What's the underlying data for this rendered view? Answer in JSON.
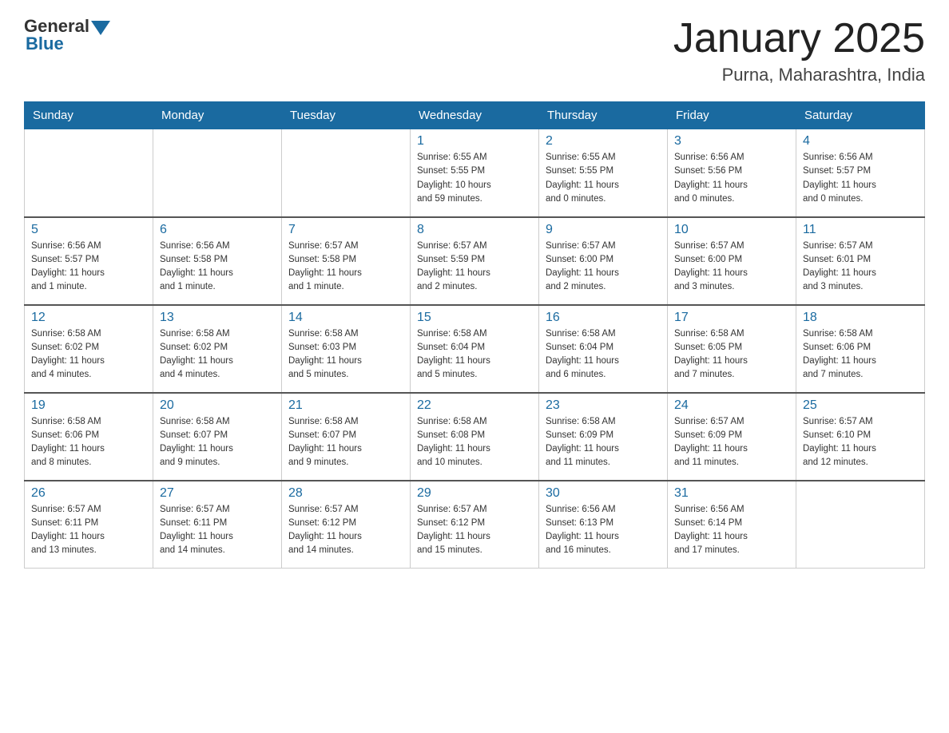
{
  "logo": {
    "general": "General",
    "blue": "Blue"
  },
  "title": {
    "month_year": "January 2025",
    "location": "Purna, Maharashtra, India"
  },
  "headers": [
    "Sunday",
    "Monday",
    "Tuesday",
    "Wednesday",
    "Thursday",
    "Friday",
    "Saturday"
  ],
  "weeks": [
    [
      {
        "day": "",
        "info": ""
      },
      {
        "day": "",
        "info": ""
      },
      {
        "day": "",
        "info": ""
      },
      {
        "day": "1",
        "info": "Sunrise: 6:55 AM\nSunset: 5:55 PM\nDaylight: 10 hours\nand 59 minutes."
      },
      {
        "day": "2",
        "info": "Sunrise: 6:55 AM\nSunset: 5:55 PM\nDaylight: 11 hours\nand 0 minutes."
      },
      {
        "day": "3",
        "info": "Sunrise: 6:56 AM\nSunset: 5:56 PM\nDaylight: 11 hours\nand 0 minutes."
      },
      {
        "day": "4",
        "info": "Sunrise: 6:56 AM\nSunset: 5:57 PM\nDaylight: 11 hours\nand 0 minutes."
      }
    ],
    [
      {
        "day": "5",
        "info": "Sunrise: 6:56 AM\nSunset: 5:57 PM\nDaylight: 11 hours\nand 1 minute."
      },
      {
        "day": "6",
        "info": "Sunrise: 6:56 AM\nSunset: 5:58 PM\nDaylight: 11 hours\nand 1 minute."
      },
      {
        "day": "7",
        "info": "Sunrise: 6:57 AM\nSunset: 5:58 PM\nDaylight: 11 hours\nand 1 minute."
      },
      {
        "day": "8",
        "info": "Sunrise: 6:57 AM\nSunset: 5:59 PM\nDaylight: 11 hours\nand 2 minutes."
      },
      {
        "day": "9",
        "info": "Sunrise: 6:57 AM\nSunset: 6:00 PM\nDaylight: 11 hours\nand 2 minutes."
      },
      {
        "day": "10",
        "info": "Sunrise: 6:57 AM\nSunset: 6:00 PM\nDaylight: 11 hours\nand 3 minutes."
      },
      {
        "day": "11",
        "info": "Sunrise: 6:57 AM\nSunset: 6:01 PM\nDaylight: 11 hours\nand 3 minutes."
      }
    ],
    [
      {
        "day": "12",
        "info": "Sunrise: 6:58 AM\nSunset: 6:02 PM\nDaylight: 11 hours\nand 4 minutes."
      },
      {
        "day": "13",
        "info": "Sunrise: 6:58 AM\nSunset: 6:02 PM\nDaylight: 11 hours\nand 4 minutes."
      },
      {
        "day": "14",
        "info": "Sunrise: 6:58 AM\nSunset: 6:03 PM\nDaylight: 11 hours\nand 5 minutes."
      },
      {
        "day": "15",
        "info": "Sunrise: 6:58 AM\nSunset: 6:04 PM\nDaylight: 11 hours\nand 5 minutes."
      },
      {
        "day": "16",
        "info": "Sunrise: 6:58 AM\nSunset: 6:04 PM\nDaylight: 11 hours\nand 6 minutes."
      },
      {
        "day": "17",
        "info": "Sunrise: 6:58 AM\nSunset: 6:05 PM\nDaylight: 11 hours\nand 7 minutes."
      },
      {
        "day": "18",
        "info": "Sunrise: 6:58 AM\nSunset: 6:06 PM\nDaylight: 11 hours\nand 7 minutes."
      }
    ],
    [
      {
        "day": "19",
        "info": "Sunrise: 6:58 AM\nSunset: 6:06 PM\nDaylight: 11 hours\nand 8 minutes."
      },
      {
        "day": "20",
        "info": "Sunrise: 6:58 AM\nSunset: 6:07 PM\nDaylight: 11 hours\nand 9 minutes."
      },
      {
        "day": "21",
        "info": "Sunrise: 6:58 AM\nSunset: 6:07 PM\nDaylight: 11 hours\nand 9 minutes."
      },
      {
        "day": "22",
        "info": "Sunrise: 6:58 AM\nSunset: 6:08 PM\nDaylight: 11 hours\nand 10 minutes."
      },
      {
        "day": "23",
        "info": "Sunrise: 6:58 AM\nSunset: 6:09 PM\nDaylight: 11 hours\nand 11 minutes."
      },
      {
        "day": "24",
        "info": "Sunrise: 6:57 AM\nSunset: 6:09 PM\nDaylight: 11 hours\nand 11 minutes."
      },
      {
        "day": "25",
        "info": "Sunrise: 6:57 AM\nSunset: 6:10 PM\nDaylight: 11 hours\nand 12 minutes."
      }
    ],
    [
      {
        "day": "26",
        "info": "Sunrise: 6:57 AM\nSunset: 6:11 PM\nDaylight: 11 hours\nand 13 minutes."
      },
      {
        "day": "27",
        "info": "Sunrise: 6:57 AM\nSunset: 6:11 PM\nDaylight: 11 hours\nand 14 minutes."
      },
      {
        "day": "28",
        "info": "Sunrise: 6:57 AM\nSunset: 6:12 PM\nDaylight: 11 hours\nand 14 minutes."
      },
      {
        "day": "29",
        "info": "Sunrise: 6:57 AM\nSunset: 6:12 PM\nDaylight: 11 hours\nand 15 minutes."
      },
      {
        "day": "30",
        "info": "Sunrise: 6:56 AM\nSunset: 6:13 PM\nDaylight: 11 hours\nand 16 minutes."
      },
      {
        "day": "31",
        "info": "Sunrise: 6:56 AM\nSunset: 6:14 PM\nDaylight: 11 hours\nand 17 minutes."
      },
      {
        "day": "",
        "info": ""
      }
    ]
  ]
}
